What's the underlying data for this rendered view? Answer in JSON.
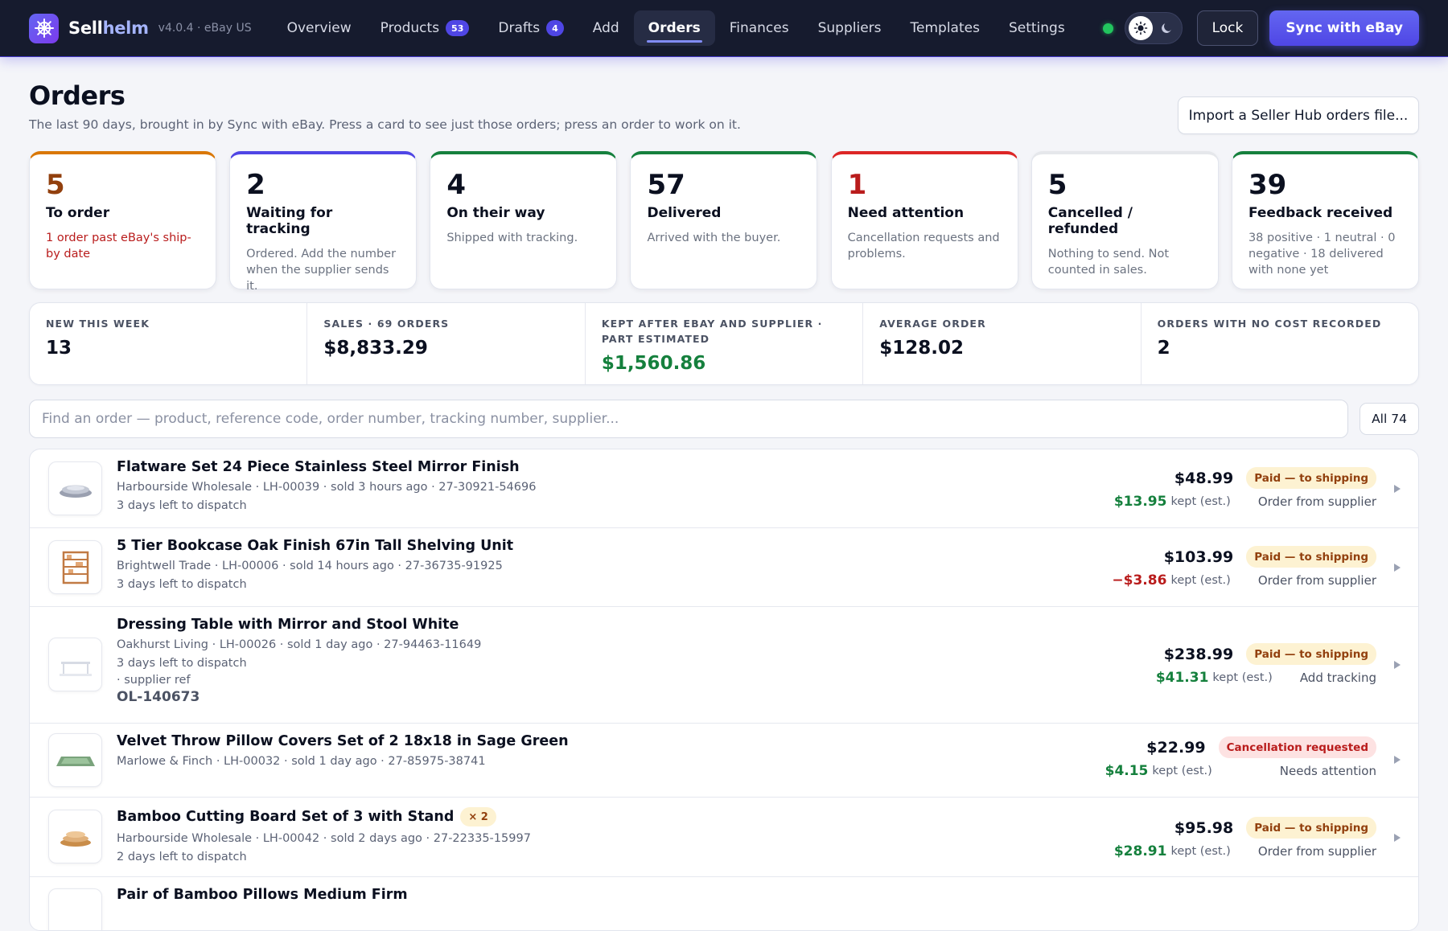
{
  "app": {
    "brand_main": "Sell",
    "brand_accent": "helm",
    "version": "v4.0.4 · eBay US",
    "accent_color": "#4f46e5"
  },
  "nav": {
    "items": [
      {
        "label": "Overview",
        "badge": ""
      },
      {
        "label": "Products",
        "badge": "53"
      },
      {
        "label": "Drafts",
        "badge": "4"
      },
      {
        "label": "Add",
        "badge": ""
      },
      {
        "label": "Orders",
        "badge": "",
        "active": true
      },
      {
        "label": "Finances",
        "badge": ""
      },
      {
        "label": "Suppliers",
        "badge": ""
      },
      {
        "label": "Templates",
        "badge": ""
      },
      {
        "label": "Settings",
        "badge": ""
      }
    ],
    "lock_label": "Lock",
    "sync_label": "Sync with eBay",
    "status_color": "#22c55e"
  },
  "header": {
    "title": "Orders",
    "subtitle": "The last 90 days, brought in by Sync with eBay. Press a card to see just those orders; press an order to work on it.",
    "import_label": "Import a Seller Hub orders file..."
  },
  "cards": [
    {
      "num": "5",
      "label": "To order",
      "desc": "1 order past eBay's ship-by date"
    },
    {
      "num": "2",
      "label": "Waiting for tracking",
      "desc": "Ordered. Add the number when the supplier sends it."
    },
    {
      "num": "4",
      "label": "On their way",
      "desc": "Shipped with tracking."
    },
    {
      "num": "57",
      "label": "Delivered",
      "desc": "Arrived with the buyer."
    },
    {
      "num": "1",
      "label": "Need attention",
      "desc": "Cancellation requests and problems."
    },
    {
      "num": "5",
      "label": "Cancelled / refunded",
      "desc": "Nothing to send. Not counted in sales."
    },
    {
      "num": "39",
      "label": "Feedback received",
      "desc": "38 positive · 1 neutral · 0 negative · 18 delivered with none yet"
    }
  ],
  "metrics": [
    {
      "label": "NEW THIS WEEK",
      "value": "13"
    },
    {
      "label": "SALES · 69 ORDERS",
      "value": "$8,833.29"
    },
    {
      "label": "KEPT AFTER EBAY AND SUPPLIER · PART ESTIMATED",
      "value": "$1,560.86"
    },
    {
      "label": "AVERAGE ORDER",
      "value": "$128.02"
    },
    {
      "label": "ORDERS WITH NO COST RECORDED",
      "value": "2"
    }
  ],
  "search": {
    "placeholder": "Find an order — product, reference code, order number, tracking number, supplier...",
    "value": "",
    "filter_label": "All 74"
  },
  "orders": [
    {
      "title": "Flatware Set 24 Piece Stainless Steel Mirror Finish",
      "qty": "",
      "meta": "Harbourside Wholesale · LH-00039 · sold 3 hours ago · 27-30921-54696",
      "line2": "3 days left to dispatch",
      "price": "$48.99",
      "status": "Paid — to shipping",
      "kept": "$13.95",
      "kept_label": "kept (est.)",
      "action": "Order from supplier"
    },
    {
      "title": "5 Tier Bookcase Oak Finish 67in Tall Shelving Unit",
      "qty": "",
      "meta": "Brightwell Trade · LH-00006 · sold 14 hours ago · 27-36735-91925",
      "line2": "3 days left to dispatch",
      "price": "$103.99",
      "status": "Paid — to shipping",
      "kept": "−$3.86",
      "kept_label": "kept (est.)",
      "action": "Order from supplier"
    },
    {
      "title": "Dressing Table with Mirror and Stool White",
      "qty": "",
      "meta": "Oakhurst Living · LH-00026 · sold 1 day ago · 27-94463-11649",
      "line2": "3 days left to dispatch",
      "line3": "· supplier ref",
      "ref": "OL-140673",
      "price": "$238.99",
      "status": "Paid — to shipping",
      "kept": "$41.31",
      "kept_label": "kept (est.)",
      "action": "Add tracking"
    },
    {
      "title": "Velvet Throw Pillow Covers Set of 2 18x18 in Sage Green",
      "qty": "",
      "meta": "Marlowe & Finch · LH-00032 · sold 1 day ago · 27-85975-38741",
      "price": "$22.99",
      "status": "Cancellation requested",
      "kept": "$4.15",
      "kept_label": "kept (est.)",
      "action": "Needs attention"
    },
    {
      "title": "Bamboo Cutting Board Set of 3 with Stand",
      "qty": "× 2",
      "meta": "Harbourside Wholesale · LH-00042 · sold 2 days ago · 27-22335-15997",
      "line2": "2 days left to dispatch",
      "price": "$95.98",
      "status": "Paid — to shipping",
      "kept": "$28.91",
      "kept_label": "kept (est.)",
      "action": "Order from supplier"
    },
    {
      "title": "Pair of Bamboo Pillows Medium Firm"
    }
  ]
}
